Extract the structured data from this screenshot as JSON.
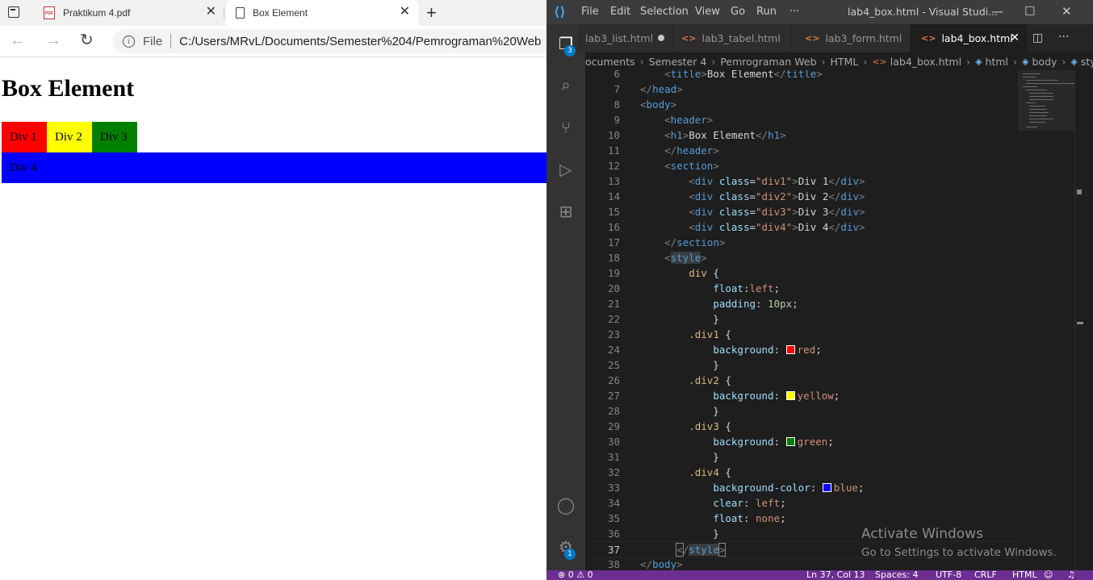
{
  "browser": {
    "tabs": [
      {
        "title": "Praktikum 4.pdf",
        "icon": "pdf-icon"
      },
      {
        "title": "Box Element",
        "icon": "page-icon",
        "active": true
      }
    ],
    "address": {
      "file_label": "File",
      "url": "C:/Users/MRvL/Documents/Semester%204/Pemrograman%20Web"
    },
    "page": {
      "heading": "Box Element",
      "boxes": [
        "Div 1",
        "Div 2",
        "Div 3"
      ],
      "box4": "Div 4"
    }
  },
  "vscode": {
    "menu": [
      "File",
      "Edit",
      "Selection",
      "View",
      "Go",
      "Run",
      "···"
    ],
    "window_title": "lab4_box.html - Visual Studi...",
    "tabs": [
      {
        "label": "lab3_list.html",
        "dirty": true
      },
      {
        "label": "lab3_tabel.html"
      },
      {
        "label": "lab3_form.html"
      },
      {
        "label": "lab4_box.html",
        "active": true
      }
    ],
    "breadcrumbs": [
      "ocuments",
      "Semester 4",
      "Pemrograman Web",
      "HTML",
      "lab4_box.html",
      "html",
      "body",
      "style"
    ],
    "line_numbers": [
      "6",
      "7",
      "8",
      "9",
      "10",
      "11",
      "12",
      "13",
      "14",
      "15",
      "16",
      "17",
      "18",
      "19",
      "20",
      "21",
      "22",
      "23",
      "24",
      "25",
      "26",
      "27",
      "28",
      "29",
      "30",
      "31",
      "32",
      "33",
      "34",
      "35",
      "36",
      "37",
      "38"
    ],
    "current_line": "37",
    "explorer_badge": "3",
    "settings_badge": "1",
    "watermark": {
      "title": "Activate Windows",
      "subtitle": "Go to Settings to activate Windows."
    },
    "statusbar": {
      "problems": "⊗ 0 ⚠ 0",
      "position": "Ln 37, Col 13",
      "spaces": "Spaces: 4",
      "encoding": "UTF-8",
      "eol": "CRLF",
      "language": "HTML"
    },
    "colors": {
      "red": "#ff0000",
      "yellow": "#ffff00",
      "green": "#008000",
      "blue": "#0000ff",
      "statusbar": "#6c2e91"
    }
  }
}
